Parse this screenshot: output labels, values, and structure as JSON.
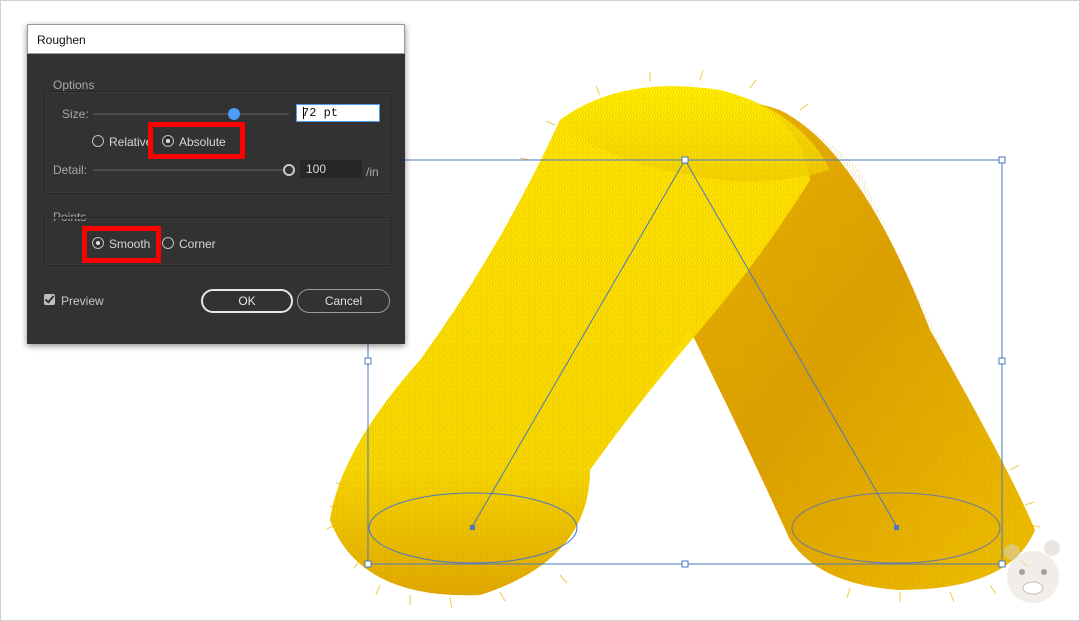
{
  "dialog": {
    "title": "Roughen",
    "options": {
      "group_label": "Options",
      "size_label": "Size:",
      "size_value": "72 pt",
      "size_slider_fraction": 0.72,
      "relative_label": "Relative",
      "absolute_label": "Absolute",
      "selected_mode": "Absolute",
      "detail_label": "Detail:",
      "detail_value": "100",
      "detail_unit": "/in",
      "detail_slider_fraction": 1.0
    },
    "points": {
      "group_label": "Points",
      "smooth_label": "Smooth",
      "corner_label": "Corner",
      "selected": "Smooth"
    },
    "preview_label": "Preview",
    "preview_checked": true,
    "ok_label": "OK",
    "cancel_label": "Cancel"
  },
  "colors": {
    "dialog_bg": "#323232",
    "highlight": "#ff0000",
    "slider_thumb": "#4a9cf5",
    "selection": "#4a78c2",
    "fur_light": "#ffe400",
    "fur_dark": "#d89400"
  },
  "icons": {
    "watermark": "bear-face-icon"
  }
}
